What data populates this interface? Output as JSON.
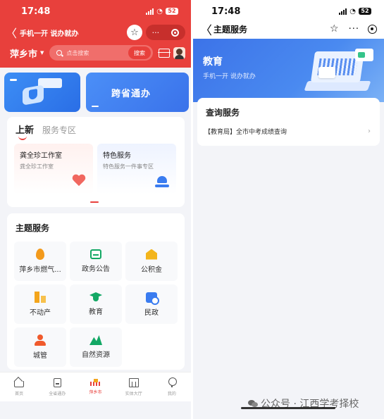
{
  "left": {
    "status": {
      "time": "17:48",
      "battery": "52"
    },
    "nav": {
      "back": "〈",
      "title": "手机一开 说办就办",
      "star": "☆",
      "more": "···"
    },
    "city": {
      "name": "萍乡市",
      "caret": "▼"
    },
    "search": {
      "placeholder": "点击搜索",
      "button": "搜索"
    },
    "banners": {
      "cross_province": "跨省通办"
    },
    "section_tabs": {
      "active": "上新",
      "other": "服务专区"
    },
    "cards": [
      {
        "title": "龚全珍工作室",
        "subtitle": "龚全珍工作室"
      },
      {
        "title": "特色服务",
        "subtitle": "特色服务一件事专区"
      }
    ],
    "theme": {
      "title": "主题服务",
      "items": [
        {
          "label": "萍乡市燃气...",
          "icon": "flame-icon"
        },
        {
          "label": "政务公告",
          "icon": "notice-board-icon"
        },
        {
          "label": "公积金",
          "icon": "housing-fund-icon"
        },
        {
          "label": "不动产",
          "icon": "real-estate-icon"
        },
        {
          "label": "教育",
          "icon": "graduation-cap-icon"
        },
        {
          "label": "民政",
          "icon": "civil-affairs-icon"
        },
        {
          "label": "城管",
          "icon": "urban-management-icon"
        },
        {
          "label": "自然资源",
          "icon": "mountain-icon"
        }
      ]
    },
    "tabbar": [
      {
        "label": "首页"
      },
      {
        "label": "全省通办"
      },
      {
        "label": "萍乡市"
      },
      {
        "label": "实体大厅"
      },
      {
        "label": "我的"
      }
    ]
  },
  "right": {
    "status": {
      "time": "17:48",
      "battery": "52"
    },
    "nav": {
      "back": "〈",
      "title": "主题服务",
      "star": "☆",
      "more": "···"
    },
    "banner": {
      "title": "教育",
      "subtitle": "手机一开 说办就办"
    },
    "query": {
      "title": "查询服务",
      "item": "【教育局】全市中考成绩查询",
      "chevron": "›"
    },
    "watermark": "公众号 · 江西学考择校"
  },
  "colors": {
    "accent_red": "#e8403c",
    "brand_blue": "#3c73e8",
    "green": "#13a865",
    "orange": "#f39a1c"
  }
}
